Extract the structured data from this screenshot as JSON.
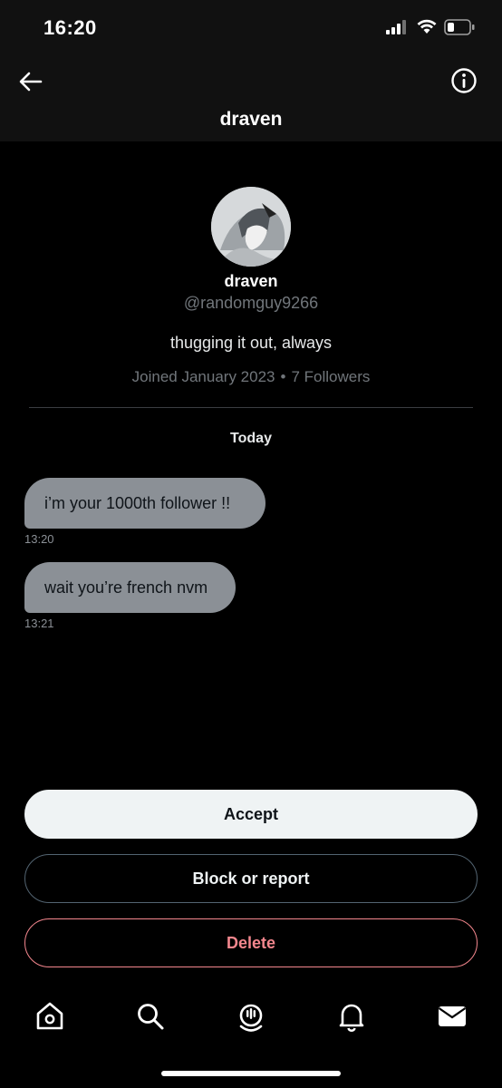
{
  "status_bar": {
    "time": "16:20"
  },
  "header": {
    "title": "draven",
    "back_icon": "arrow-left-icon",
    "info_icon": "info-circle-icon"
  },
  "profile": {
    "name": "draven",
    "handle": "@randomguy9266",
    "bio": "thugging it out, always",
    "joined": "Joined January 2023",
    "separator": "•",
    "followers": "7 Followers"
  },
  "conversation": {
    "date_label": "Today",
    "messages": [
      {
        "text": "i’m your 1000th follower !!",
        "time": "13:20"
      },
      {
        "text": "wait you’re french nvm",
        "time": "13:21"
      }
    ]
  },
  "actions": {
    "accept": "Accept",
    "block": "Block or report",
    "delete": "Delete"
  },
  "colors": {
    "delete_red": "#f4878e",
    "bubble_gray": "#8b9096",
    "background": "#000000"
  },
  "tabbar": {
    "items": [
      {
        "icon": "home-icon"
      },
      {
        "icon": "search-icon"
      },
      {
        "icon": "spaces-icon"
      },
      {
        "icon": "bell-icon"
      },
      {
        "icon": "mail-icon",
        "active": true
      }
    ]
  }
}
